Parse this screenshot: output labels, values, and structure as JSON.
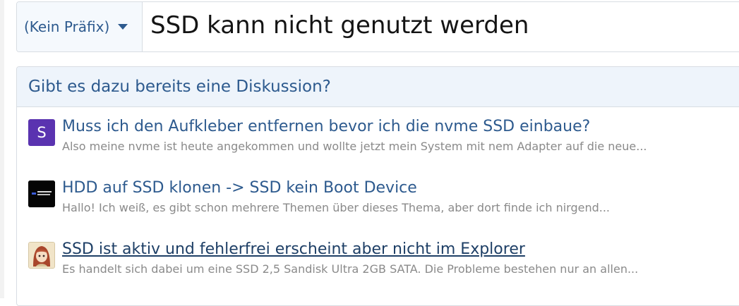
{
  "title_row": {
    "prefix_label": "(Kein Präfix)",
    "title_value": "SSD kann nicht genutzt werden"
  },
  "similar_threads": {
    "heading": "Gibt es dazu bereits eine Diskussion?",
    "items": [
      {
        "avatar_letter": "S",
        "title": "Muss ich den Aufkleber entfernen bevor ich die nvme SSD einbaue?",
        "snippet": "Also meine nvme ist heute angekommen und wollte jetzt mein System mit nem Adapter auf die neue..."
      },
      {
        "title": "HDD auf SSD klonen -> SSD kein Boot Device",
        "snippet": "Hallo! Ich weiß, es gibt schon mehrere Themen über dieses Thema, aber dort finde ich nirgend..."
      },
      {
        "title": "SSD ist aktiv und fehlerfrei erscheint aber nicht im Explorer",
        "snippet": "Es handelt sich dabei um eine SSD 2,5 Sandisk Ultra 2GB SATA. Die Probleme bestehen nur an allen..."
      }
    ]
  },
  "icons": {
    "prefix_dropdown": "chevron-down-icon"
  },
  "colors": {
    "link": "#2d5a8e",
    "header_bg": "#eef4fb",
    "prefix_bg": "#f5f9fd",
    "border": "#d8dde3",
    "snippet": "#8a8a8a",
    "avatar_purple": "#5a33b0"
  }
}
